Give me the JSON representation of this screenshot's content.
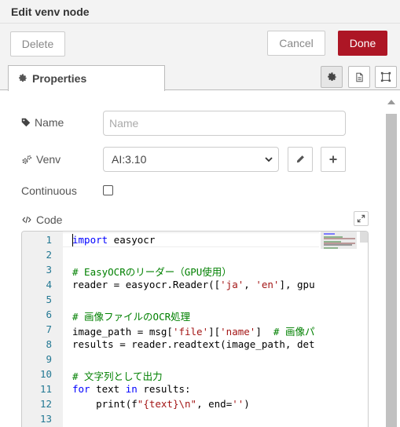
{
  "header": {
    "title": "Edit venv node"
  },
  "toolbar": {
    "delete_label": "Delete",
    "cancel_label": "Cancel",
    "done_label": "Done"
  },
  "tabs": {
    "properties_label": "Properties"
  },
  "form": {
    "name_label": "Name",
    "name_placeholder": "Name",
    "name_value": "",
    "venv_label": "Venv",
    "venv_value": "AI:3.10",
    "continuous_label": "Continuous",
    "continuous_checked": false,
    "code_label": "Code"
  },
  "colors": {
    "done_bg": "#ad1625",
    "line_number": "#237893",
    "keyword": "#0000ff",
    "string": "#a31515",
    "comment": "#008000"
  },
  "editor": {
    "line_numbers": [
      "1",
      "2",
      "3",
      "4",
      "5",
      "6",
      "7",
      "8",
      "9",
      "10",
      "11",
      "12",
      "13"
    ],
    "lines": [
      "import easyocr",
      "",
      "# EasyOCRのリーダー（GPU使用）",
      "reader = easyocr.Reader(['ja', 'en'], gpu",
      "",
      "# 画像ファイルのOCR処理",
      "image_path = msg['file']['name']  # 画像パ",
      "results = reader.readtext(image_path, det",
      "",
      "# 文字列として出力",
      "for text in results:",
      "    print(f\"{text}\\n\", end='')",
      ""
    ]
  }
}
